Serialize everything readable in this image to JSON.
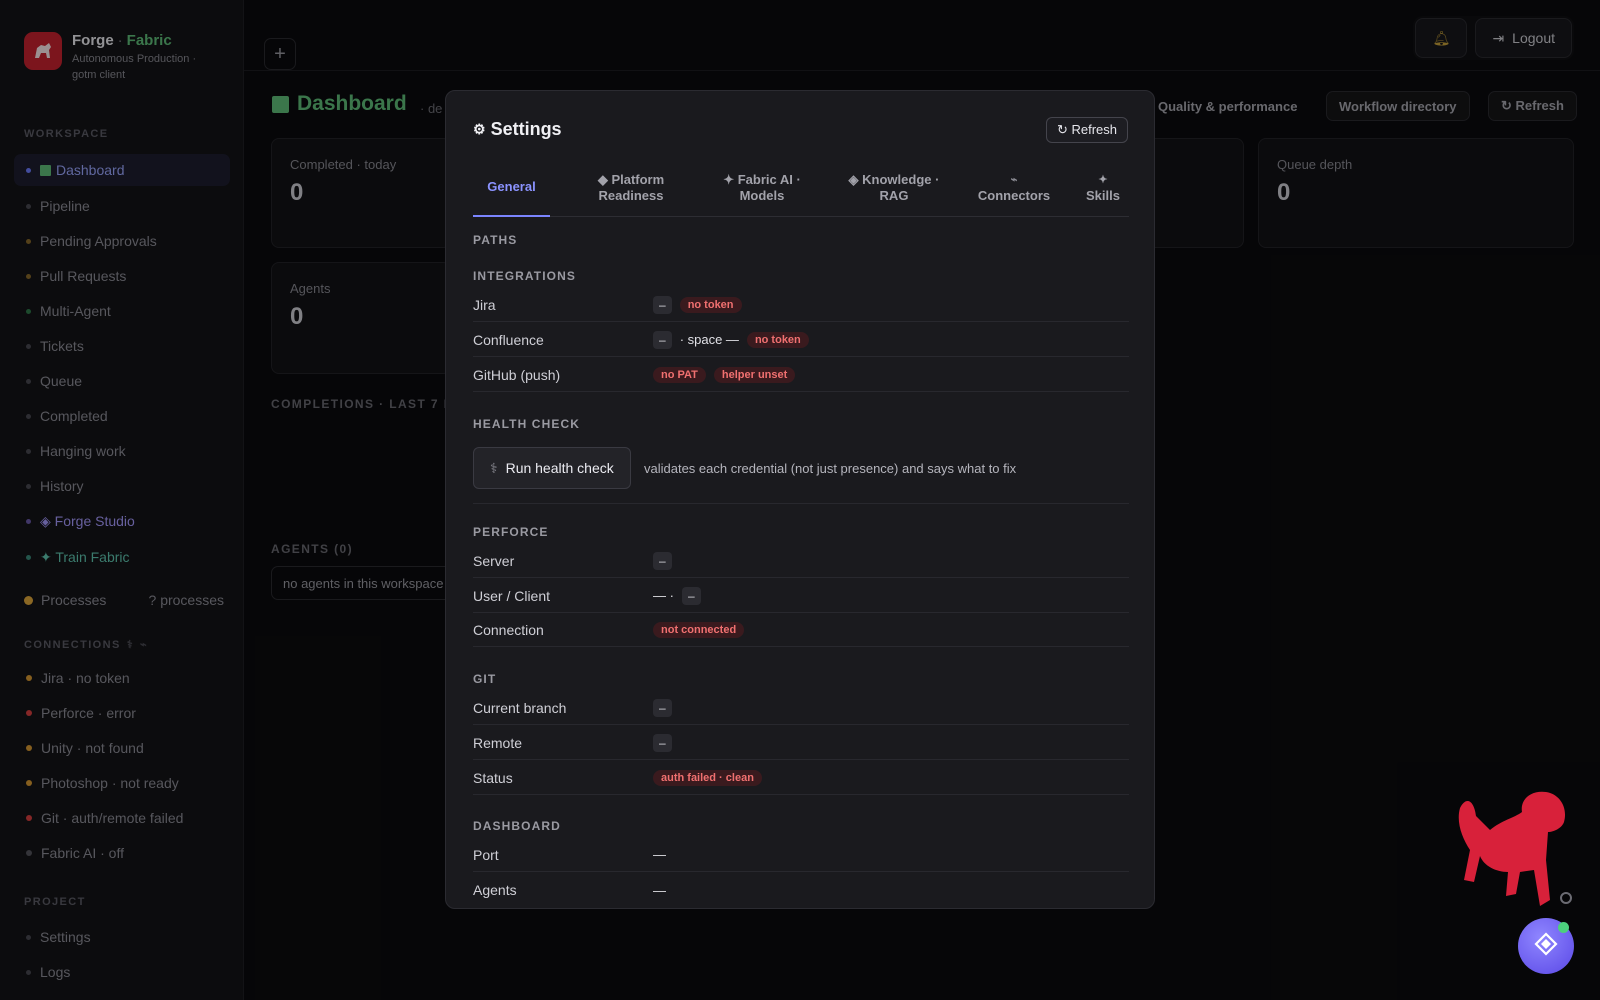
{
  "brand": {
    "name": "Forge",
    "accent": "Fabric",
    "subtitle": "Autonomous Production · gotm client"
  },
  "sidebar": {
    "workspace_label": "WORKSPACE",
    "items": [
      {
        "label": "Dashboard"
      },
      {
        "label": "Pipeline"
      },
      {
        "label": "Pending Approvals"
      },
      {
        "label": "Pull Requests"
      },
      {
        "label": "Multi-Agent"
      },
      {
        "label": "Tickets"
      },
      {
        "label": "Queue"
      },
      {
        "label": "Completed"
      },
      {
        "label": "Hanging work"
      },
      {
        "label": "History"
      },
      {
        "label": "◈ Forge Studio"
      },
      {
        "label": "✦ Train Fabric"
      }
    ],
    "processes_label": "Processes",
    "processes_count": "? processes",
    "connections_label": "CONNECTIONS",
    "connections": [
      {
        "label": "Jira · no token",
        "color": "#d99a32"
      },
      {
        "label": "Perforce · error",
        "color": "#d94040"
      },
      {
        "label": "Unity · not found",
        "color": "#d99a32"
      },
      {
        "label": "Photoshop · not ready",
        "color": "#d99a32"
      },
      {
        "label": "Git · auth/remote failed",
        "color": "#d94040"
      },
      {
        "label": "Fabric AI · off",
        "color": "#55555c"
      }
    ],
    "project_label": "PROJECT",
    "project_items": [
      {
        "label": "Settings"
      },
      {
        "label": "Logs"
      }
    ]
  },
  "topbar": {
    "bell_icon": "bell-icon",
    "logout_label": "Logout"
  },
  "dashboard": {
    "title": "Dashboard",
    "subtitle": "· de",
    "quality_label": "Quality & performance",
    "workflow_label": "Workflow directory",
    "refresh_label": "↻ Refresh",
    "cards": [
      {
        "label": "Completed · today",
        "value": "0"
      },
      {
        "label": "Queue depth",
        "value": "0"
      },
      {
        "label": "Agents",
        "value": "0"
      }
    ],
    "completions_caption": "COMPLETIONS · LAST 7 DA",
    "agents_caption": "AGENTS (0)",
    "agents_empty": "no agents in this workspace"
  },
  "modal": {
    "title": "Settings",
    "refresh_label": "↻ Refresh",
    "tabs": [
      {
        "label": "General"
      },
      {
        "label": "◆ Platform Readiness"
      },
      {
        "label": "✦ Fabric AI · Models"
      },
      {
        "label": "◈ Knowledge · RAG"
      },
      {
        "label": "Connectors"
      },
      {
        "label": "Skills"
      }
    ],
    "paths_label": "PATHS",
    "integrations_label": "INTEGRATIONS",
    "integrations": {
      "jira": {
        "label": "Jira",
        "value": "–",
        "badge": "no token"
      },
      "confluence": {
        "label": "Confluence",
        "value": "–",
        "space": "· space —",
        "badge": "no token"
      },
      "github": {
        "label": "GitHub (push)",
        "badge1": "no PAT",
        "badge2": "helper unset"
      }
    },
    "health_label": "HEALTH CHECK",
    "health_button": "Run health check",
    "health_desc": "validates each credential (not just presence) and says what to fix",
    "perforce_label": "PERFORCE",
    "perforce": {
      "server": {
        "label": "Server",
        "value": "–"
      },
      "user": {
        "label": "User / Client",
        "prefix": "— ·",
        "value": "–"
      },
      "connection": {
        "label": "Connection",
        "badge": "not connected"
      }
    },
    "git_label": "GIT",
    "git": {
      "branch": {
        "label": "Current branch",
        "value": "–"
      },
      "remote": {
        "label": "Remote",
        "value": "–"
      },
      "status": {
        "label": "Status",
        "badge": "auth failed · clean"
      }
    },
    "dashboard_label": "DASHBOARD",
    "dash": {
      "port": {
        "label": "Port",
        "value": "—"
      },
      "agents": {
        "label": "Agents",
        "value": "—"
      }
    }
  },
  "colors": {
    "accent_green": "#5fbf7a",
    "accent_blue": "#7b85ff",
    "error_red": "#f07070",
    "mascot_red": "#d8213a"
  }
}
